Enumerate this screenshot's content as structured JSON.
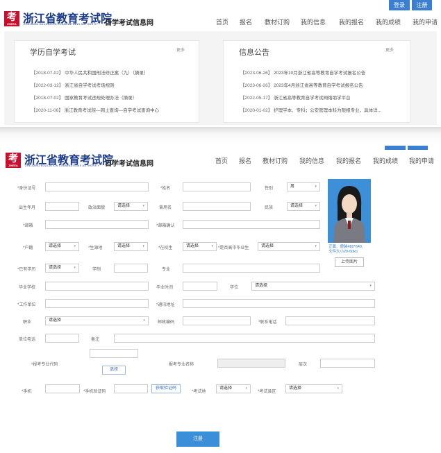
{
  "auth": {
    "login": "登录",
    "register": "注册"
  },
  "site": {
    "title": "浙江省教育考试院",
    "subtitle": "ZHEJIANG EDUCATION EXAMINATIONS AUTHORITY",
    "tag": "自学考试信息网",
    "logo_char": "考",
    "logo_small": "ZHEEA"
  },
  "nav": [
    "首页",
    "报名",
    "教材订购",
    "我的信息",
    "我的报名",
    "我的成绩",
    "我的申请"
  ],
  "panels": {
    "left": {
      "title": "学历自学考试",
      "more": "更多",
      "items": [
        {
          "date": "【2018-07-02】",
          "text": "中华人民共和国刑法修正案（九）（摘录）"
        },
        {
          "date": "【2022-03-12】",
          "text": "浙江省自学考试考场规则"
        },
        {
          "date": "【2018-07-02】",
          "text": "国家教育考试违规处理办法（摘录）"
        },
        {
          "date": "【2020-11-06】",
          "text": "浙江教育考试院—网上查询—自学考试查询中心"
        }
      ]
    },
    "right": {
      "title": "信息公告",
      "more": "更多",
      "items": [
        {
          "date": "【2023-06-26】",
          "text": "2023年10月浙江省高等教育自学考试报名公告"
        },
        {
          "date": "【2023-06-26】",
          "text": "2023年4月浙江省高等教育自学考试报名公告"
        },
        {
          "date": "【2022-05-17】",
          "text": "浙江省高等教育自学考试网络助学平台"
        },
        {
          "date": "【2020-01-02】",
          "text": "护理学本、专科；公安管理本科为限报专业，具体详..."
        }
      ]
    }
  },
  "form": {
    "id_number": "*身份证号",
    "name": "*姓名",
    "gender": "性别",
    "gender_value": "男",
    "birth": "出生年月",
    "politics": "政治面貌",
    "used_name": "曾用名",
    "ethnicity": "民族",
    "email": "*邮箱",
    "email_confirm": "*邮箱确认",
    "hukou": "*户籍",
    "birthplace": "*生源地",
    "current": "*在校生",
    "hs_grad": "*是否高中毕业生",
    "education": "*已有学历",
    "school_system": "学制",
    "major": "专业",
    "grad_school": "毕业学校",
    "grad_time": "毕业时间",
    "degree": "学位",
    "employer": "*工作单位",
    "address": "*通讯地址",
    "occupation": "职业",
    "postcode": "邮政编码",
    "contact_phone": "*联系电话",
    "unit_phone": "单位电话",
    "remark": "备注",
    "guide_code": "*报考专业代码",
    "guide_name": "报考专业名称",
    "level": "层次",
    "choose": "选择",
    "mobile": "*手机",
    "mobile_code": "*手机验证码",
    "get_code": "获取验证码",
    "exam_city": "*考试地",
    "exam_area": "*考试县区",
    "please_select": "请选择",
    "upload": "上传图片",
    "photo_note1": "正面、便装480*640,",
    "photo_note2": "文件大小20-60kb",
    "submit": "注册"
  },
  "colors": {
    "brand": "#1a3a8a",
    "accent": "#3a7fd0",
    "logo": "#c8102e"
  }
}
